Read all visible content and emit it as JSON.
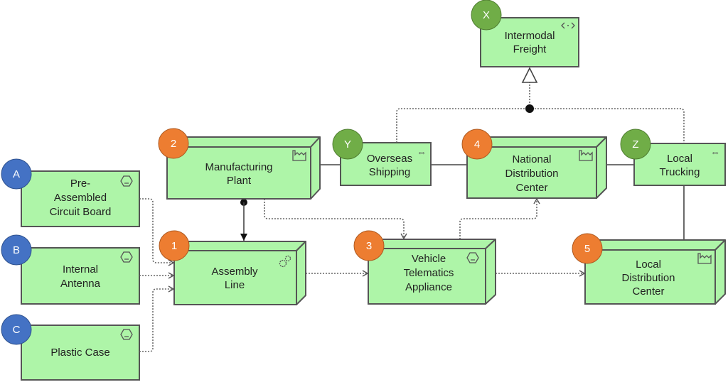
{
  "colors": {
    "node_fill": "#aef5a8",
    "badge_orange": "#ed7d31",
    "badge_green": "#70ad47",
    "badge_blue": "#4472c4"
  },
  "nodes": {
    "intermodal": {
      "badge": "X",
      "lines": [
        "Intermodal",
        "Freight"
      ],
      "icon": "interface-icon"
    },
    "manufacturing": {
      "badge": "2",
      "lines": [
        "Manufacturing",
        "Plant"
      ],
      "icon": "facility-icon"
    },
    "overseas": {
      "badge": "Y",
      "lines": [
        "Overseas",
        "Shipping"
      ],
      "icon": "path-icon"
    },
    "national": {
      "badge": "4",
      "lines": [
        "National",
        "Distribution",
        "Center"
      ],
      "icon": "facility-icon"
    },
    "trucking": {
      "badge": "Z",
      "lines": [
        "Local",
        "Trucking"
      ],
      "icon": "path-icon"
    },
    "circuit": {
      "badge": "A",
      "lines": [
        "Pre-",
        "Assembled",
        "Circuit Board"
      ],
      "icon": "material-icon"
    },
    "antenna": {
      "badge": "B",
      "lines": [
        "Internal",
        "Antenna"
      ],
      "icon": "material-icon"
    },
    "case": {
      "badge": "C",
      "lines": [
        "Plastic Case"
      ],
      "icon": "material-icon"
    },
    "assembly": {
      "badge": "1",
      "lines": [
        "Assembly",
        "Line"
      ],
      "icon": "equipment-icon"
    },
    "telematics": {
      "badge": "3",
      "lines": [
        "Vehicle",
        "Telematics",
        "Appliance"
      ],
      "icon": "material-icon"
    },
    "local_dc": {
      "badge": "5",
      "lines": [
        "Local",
        "Distribution",
        "Center"
      ],
      "icon": "facility-icon"
    }
  }
}
